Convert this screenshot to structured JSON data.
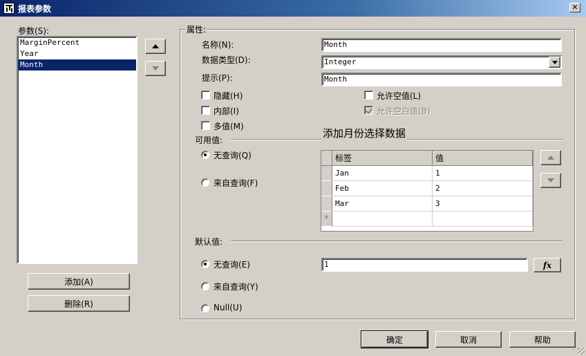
{
  "window": {
    "title": "报表参数",
    "close_glyph": "✕"
  },
  "params": {
    "label": "参数(S):",
    "items": [
      "MarginPercent",
      "Year",
      "Month"
    ],
    "selected_index": 2,
    "add_label": "添加(A)",
    "delete_label": "删除(R)"
  },
  "props": {
    "group_label": "属性:",
    "name_label": "名称(N):",
    "name_value": "Month",
    "type_label": "数据类型(D):",
    "type_value": "Integer",
    "prompt_label": "提示(P):",
    "prompt_value": "Month",
    "hidden_label": "隐藏(H)",
    "internal_label": "内部(I)",
    "multi_label": "多值(M)",
    "allow_null_label": "允许空值(L)",
    "allow_blank_label": "允许空白值(B)",
    "allow_blank_checked": true
  },
  "available": {
    "label": "可用值:",
    "annotation": "添加月份选择数据",
    "no_query_label": "无查询(Q)",
    "from_query_label": "来自查询(F)",
    "col_label_header": "标签",
    "col_value_header": "值",
    "rows": [
      {
        "label": "Jan",
        "value": "1"
      },
      {
        "label": "Feb",
        "value": "2"
      },
      {
        "label": "Mar",
        "value": "3"
      }
    ],
    "new_row_marker": "*"
  },
  "defaults": {
    "label": "默认值:",
    "no_query_label": "无查询(E)",
    "from_query_label": "来自查询(Y)",
    "null_label": "Null(U)",
    "value": "1",
    "fx_label": "fx"
  },
  "footer": {
    "ok_label": "确定",
    "cancel_label": "取消",
    "help_label": "帮助"
  }
}
